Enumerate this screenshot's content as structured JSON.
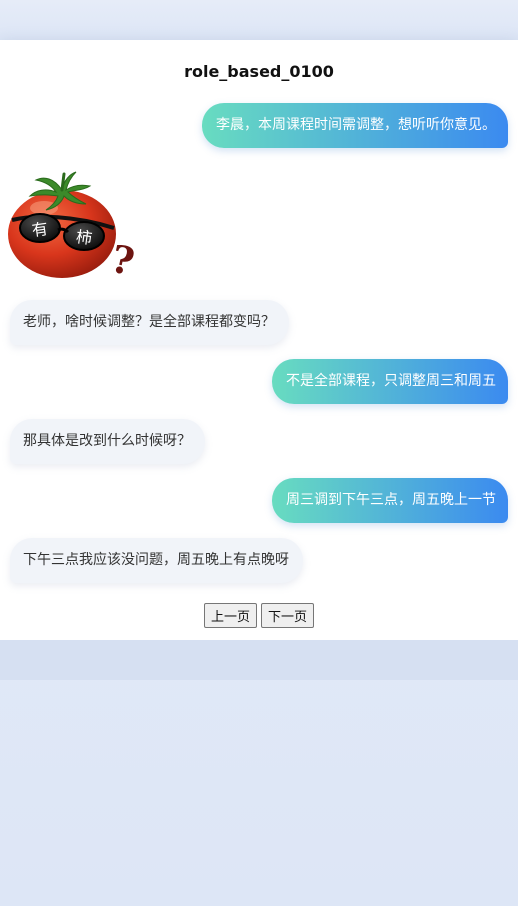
{
  "title": "role_based_0100",
  "messages": [
    {
      "side": "right",
      "text": "李晨，本周课程时间需调整，想听听你意见。"
    },
    {
      "side": "left",
      "type": "sticker",
      "text": "有柿",
      "icon": "tomato-sunglasses-sticker"
    },
    {
      "side": "left",
      "text": "老师，啥时候调整？是全部课程都变吗？"
    },
    {
      "side": "right",
      "text": "不是全部课程，只调整周三和周五"
    },
    {
      "side": "left",
      "text": "那具体是改到什么时候呀？"
    },
    {
      "side": "right",
      "text": "周三调到下午三点，周五晚上一节"
    },
    {
      "side": "left",
      "text": "下午三点我应该没问题，周五晚上有点晚呀"
    }
  ],
  "pager": {
    "prev_label": "上一页",
    "next_label": "下一页"
  },
  "colors": {
    "bubble_right_start": "#68dcc0",
    "bubble_right_end": "#3b8af0",
    "bubble_left_bg": "#f1f4f9"
  }
}
